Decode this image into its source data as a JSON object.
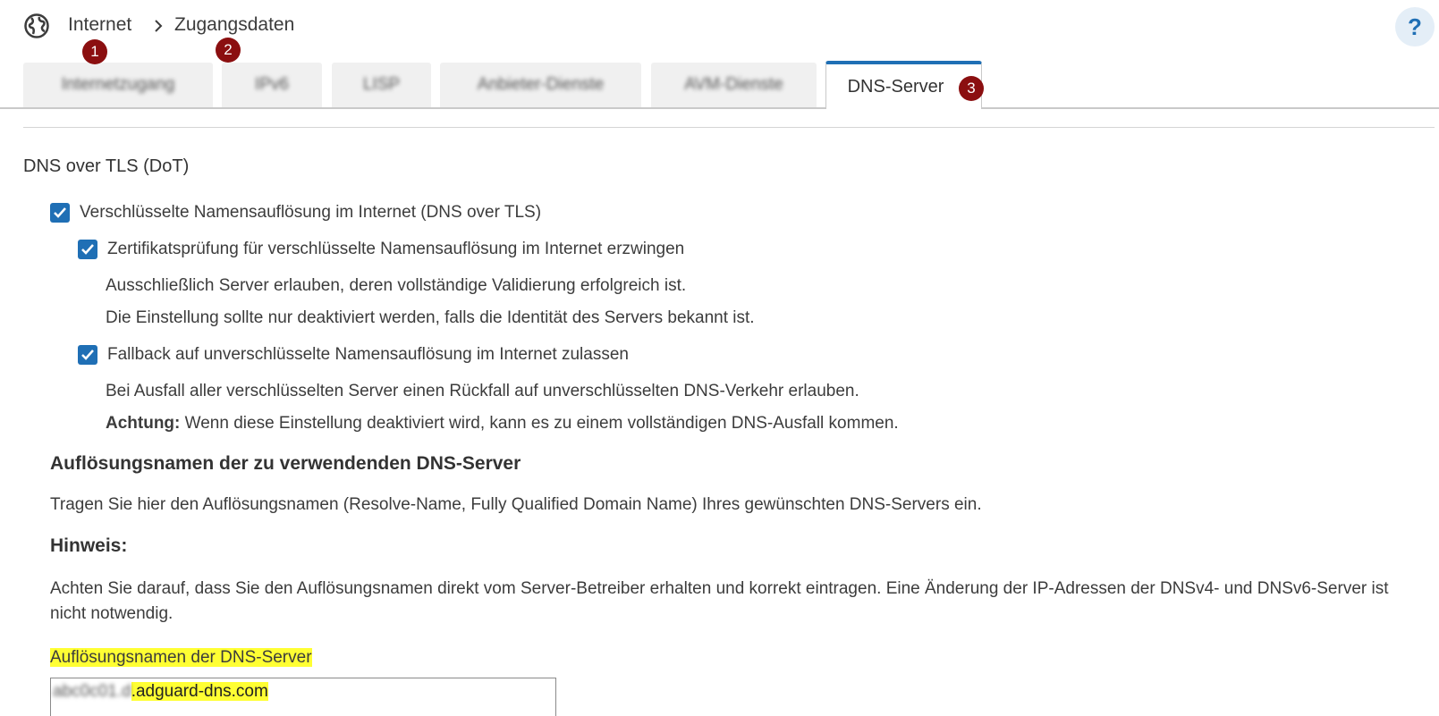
{
  "header": {
    "globe_icon": "globe-icon",
    "breadcrumb": [
      "Internet",
      "Zugangsdaten"
    ],
    "separator_icon": "chevron-right-icon",
    "help_label": "?"
  },
  "markers": [
    "1",
    "2",
    "3"
  ],
  "tabs": [
    {
      "label": "Internetzugang",
      "blurred": true
    },
    {
      "label": "IPv6",
      "blurred": true
    },
    {
      "label": "LISP",
      "blurred": true
    },
    {
      "label": "Anbieter-Dienste",
      "blurred": true
    },
    {
      "label": "AVM-Dienste",
      "blurred": true
    },
    {
      "label": "DNS-Server",
      "blurred": false,
      "active": true
    }
  ],
  "section": {
    "title": "DNS over TLS (DoT)",
    "options": [
      {
        "label": "Verschlüsselte Namensauflösung im Internet (DNS over TLS)",
        "checked": true
      },
      {
        "label": "Zertifikatsprüfung für verschlüsselte Namensauflösung im Internet erzwingen",
        "checked": true,
        "help": [
          "Ausschließlich Server erlauben, deren vollständige Validierung erfolgreich ist.",
          "Die Einstellung sollte nur deaktiviert werden, falls die Identität des Servers bekannt ist."
        ]
      },
      {
        "label": "Fallback auf unverschlüsselte Namensauflösung im Internet zulassen",
        "checked": true,
        "help": [
          "Bei Ausfall aller verschlüsselten Server einen Rückfall auf unverschlüsselten DNS-Verkehr erlauben."
        ],
        "warning_label": "Achtung:",
        "warning_text": " Wenn diese Einstellung deaktiviert wird, kann es zu einem vollständigen DNS-Ausfall kommen."
      }
    ]
  },
  "resolver": {
    "heading": "Auflösungsnamen der zu verwendenden DNS-Server",
    "description": "Tragen Sie hier den Auflösungsnamen (Resolve-Name, Fully Qualified Domain Name) Ihres gewünschten DNS-Servers ein.",
    "note_heading": "Hinweis:",
    "note_text": "Achten Sie darauf, dass Sie den Auflösungsnamen direkt vom Server-Betreiber erhalten und korrekt eintragen. Eine Änderung der IP-Adressen der DNSv4- und DNSv6-Server ist nicht notwendig.",
    "field_label": "Auflösungsnamen der DNS-Server",
    "field_value_hidden": "abc0c01.d",
    "field_value_visible": ".adguard-dns.com"
  },
  "colors": {
    "accent": "#1f6fb5",
    "marker": "#8b0f10",
    "highlight": "#ffff33"
  }
}
